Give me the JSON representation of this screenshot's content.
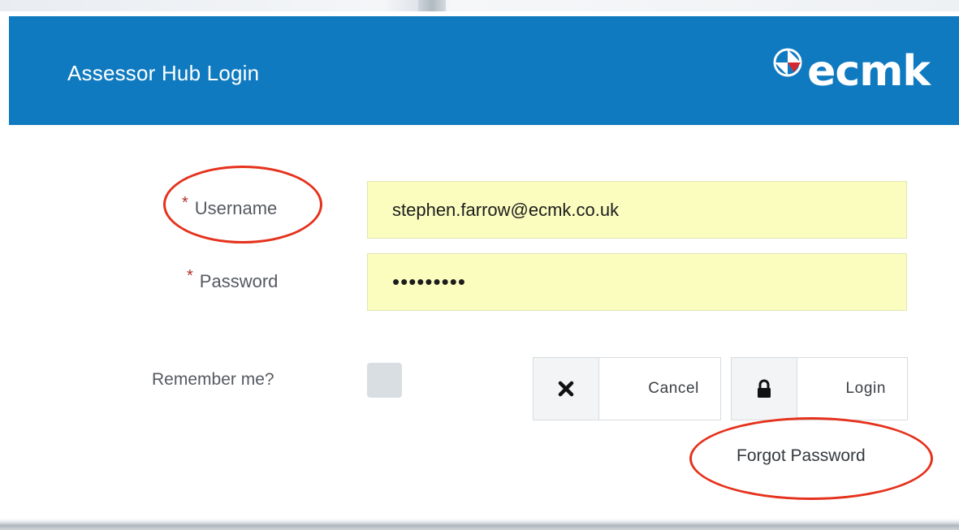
{
  "window": {
    "title": "Assessor Hub Login",
    "logo_text": "ecmk",
    "brand_color": "#0f7ac0"
  },
  "form": {
    "username": {
      "label": "Username",
      "required_marker": "*",
      "value": "stephen.farrow@ecmk.co.uk"
    },
    "password": {
      "label": "Password",
      "required_marker": "*",
      "masked_value": "•••••••••"
    },
    "remember_me": {
      "label": "Remember me?",
      "checked": false
    },
    "cancel": {
      "label": "Cancel",
      "icon": "close-icon"
    },
    "login": {
      "label": "Login",
      "icon": "lock-icon"
    },
    "forgot_password": {
      "label": "Forgot Password"
    }
  },
  "annotations": {
    "highlight_color": "#e5321c",
    "highlighted": [
      "Username",
      "Forgot Password"
    ]
  },
  "colors": {
    "input_background": "#fbfdbf",
    "required_marker": "#b0302b",
    "checkbox": "#d9dee2"
  }
}
